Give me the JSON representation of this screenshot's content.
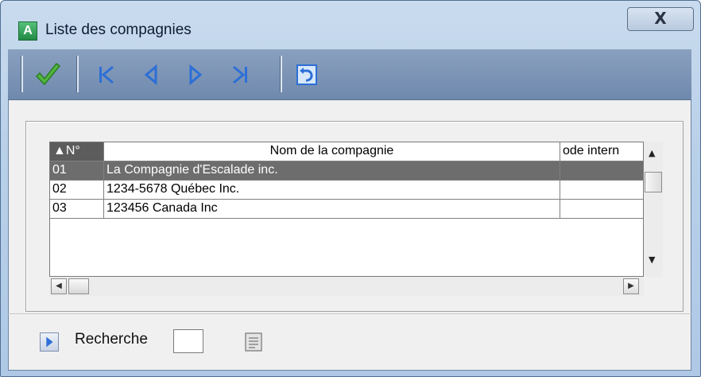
{
  "window": {
    "title": "Liste des compagnies",
    "close_label": "X",
    "app_icon_letter": "A"
  },
  "toolbar": {
    "buttons": [
      {
        "name": "ok",
        "icon": "checkmark-icon"
      },
      {
        "name": "first",
        "icon": "first-record-icon"
      },
      {
        "name": "previous",
        "icon": "previous-record-icon"
      },
      {
        "name": "next",
        "icon": "next-record-icon"
      },
      {
        "name": "last",
        "icon": "last-record-icon"
      },
      {
        "name": "undo",
        "icon": "undo-icon"
      }
    ],
    "check_color": "#3aa52e",
    "nav_color": "#2d6fd6"
  },
  "grid": {
    "columns": [
      "▲N°",
      "Nom de la compagnie",
      "ode intern"
    ],
    "rows": [
      {
        "num": "01",
        "name": "La Compagnie d'Escalade inc.",
        "code": ""
      },
      {
        "num": "02",
        "name": "1234-5678 Québec Inc.",
        "code": ""
      },
      {
        "num": "03",
        "name": "123456 Canada Inc",
        "code": ""
      }
    ],
    "selected_row": 0
  },
  "footer": {
    "search_label": "Recherche",
    "search_value": ""
  }
}
